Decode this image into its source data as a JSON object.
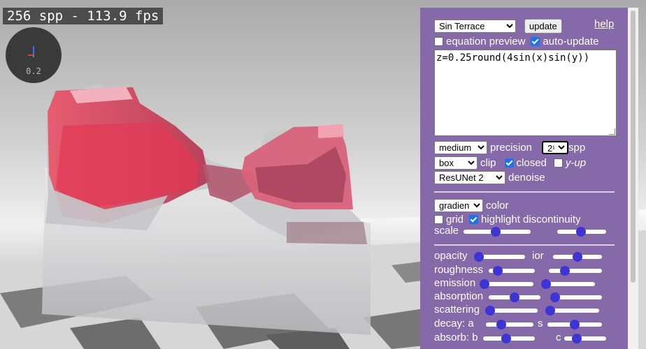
{
  "hud": {
    "fps_text": "256 spp - 113.9 fps",
    "gizmo_value": "0.2"
  },
  "panel": {
    "preset": "Sin Terrace",
    "update_label": "update",
    "help_label": "help",
    "equation_preview_label": "equation preview",
    "equation_preview_checked": false,
    "auto_update_label": "auto-update",
    "auto_update_checked": true,
    "equation": "z=0.25round(4sin(x)sin(y))",
    "precision_value": "medium",
    "precision_label": "precision",
    "spp_value": "2⁸",
    "spp_label": "spp",
    "clip_value": "box",
    "clip_label": "clip",
    "closed_label": "closed",
    "closed_checked": true,
    "yup_label": "y-up",
    "yup_checked": false,
    "denoise_value": "ResUNet 2",
    "denoise_label": "denoise",
    "color_value": "gradient",
    "color_label": "color",
    "grid_label": "grid",
    "grid_checked": false,
    "highlight_label": "highlight discontinuity",
    "highlight_checked": true,
    "scale_label": "scale",
    "scale_a": 0.48,
    "scale_b": 0.48,
    "opacity_label": "opacity",
    "opacity": 0.06,
    "ior_label": "ior",
    "ior": 0.5,
    "roughness_label": "roughness",
    "roughness": 0.2,
    "roughness_b": 0.3,
    "emission_label": "emission",
    "emission": 0.05,
    "emission_b": 0.05,
    "absorption_label": "absorption",
    "absorption": 0.5,
    "absorption_b": 0.1,
    "scattering_label": "scattering",
    "scattering": 0.05,
    "scattering_b": 0.05,
    "decay_a_label": "decay: a",
    "decay_a": 0.33,
    "decay_s_label": "s",
    "decay_s": 0.5,
    "absorb_b_label": "absorb: b",
    "absorb_b": 0.45,
    "absorb_c_label": "c",
    "absorb_c": 0.3
  }
}
